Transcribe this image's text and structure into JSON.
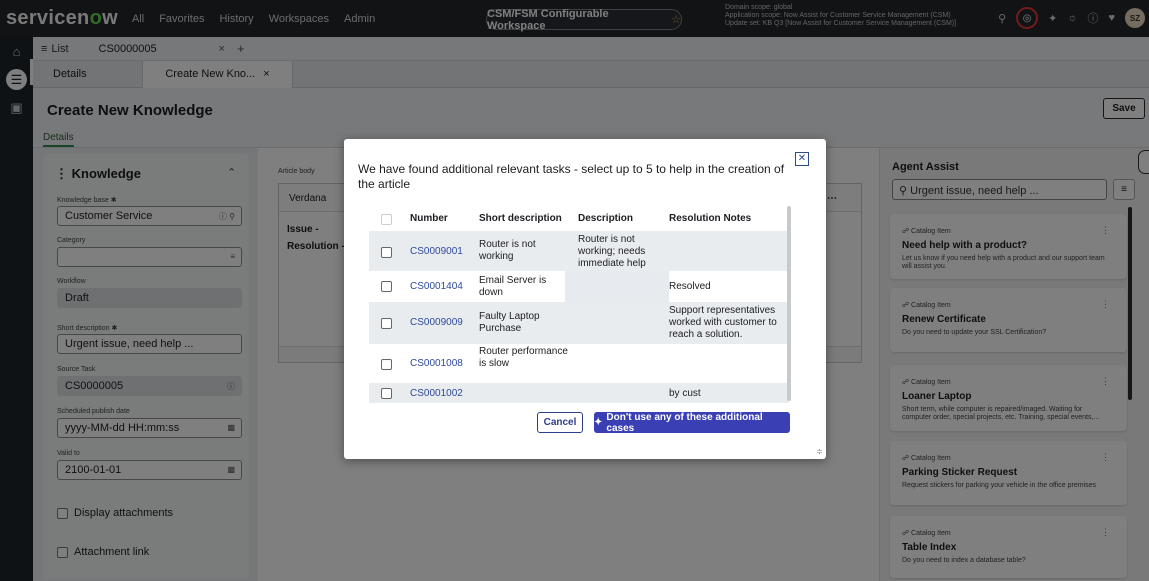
{
  "topbar": {
    "logo_pre": "servicen",
    "logo_o": "o",
    "logo_post": "w",
    "nav": [
      "All",
      "Favorites",
      "History",
      "Workspaces",
      "Admin"
    ],
    "workspace": "CSM/FSM Configurable Workspace",
    "scope_line1": "Domain scope: global",
    "scope_line2": "Application scope: Now Assist for Customer Service Management (CSM)",
    "scope_line3": "Update set: KB Q3 [Now Assist for Customer Service Management (CSM)]",
    "avatar": "SZ"
  },
  "tabs1": {
    "list": "List",
    "record": "CS0000005",
    "close": "×",
    "add": "+"
  },
  "tabs2": {
    "details": "Details",
    "create": "Create New Kno...",
    "close": "×"
  },
  "page": {
    "title": "Create New Knowledge",
    "subtab": "Details",
    "save": "Save"
  },
  "form": {
    "section": "Knowledge",
    "kb_label": "Knowledge base",
    "kb_value": "Customer Service",
    "category_label": "Category",
    "category_value": "",
    "workflow_label": "Workflow",
    "workflow_value": "Draft",
    "short_label": "Short description",
    "short_value": "Urgent issue, need help ...",
    "source_label": "Source Task",
    "source_value": "CS0000005",
    "sched_label": "Scheduled publish date",
    "sched_value": "yyyy-MM-dd HH:mm:ss",
    "valid_label": "Valid to",
    "valid_value": "2100-01-01",
    "display_attachments": "Display attachments",
    "attachment_link": "Attachment link"
  },
  "editor": {
    "label": "Article body",
    "font": "Verdana",
    "issue": "Issue -",
    "resolution": "Resolution -"
  },
  "assist": {
    "title": "Agent Assist",
    "search": "Urgent issue, need help ...",
    "cards": [
      {
        "type": "Catalog Item",
        "title": "Need help with a product?",
        "desc": "Let us know if you need help with a product and our support team will assist you."
      },
      {
        "type": "Catalog Item",
        "title": "Renew Certificate",
        "desc": "Do you need to update your SSL Certification?"
      },
      {
        "type": "Catalog Item",
        "title": "Loaner Laptop",
        "desc": "Short term, while computer is repaired/imaged. Waiting for computer order, special projects, etc. Training, special events,..."
      },
      {
        "type": "Catalog Item",
        "title": "Parking Sticker Request",
        "desc": "Request stickers for parking your vehicle in the office premises"
      },
      {
        "type": "Catalog Item",
        "title": "Table Index",
        "desc": "Do you need to index a database table?"
      }
    ]
  },
  "modal": {
    "title": "We have found additional relevant tasks - select up to 5 to help in the creation of the article",
    "headers": [
      "Number",
      "Short description",
      "Description",
      "Resolution Notes"
    ],
    "rows": [
      {
        "number": "CS0009001",
        "short": "Router is not working",
        "desc": "Router is not working; needs immediate help",
        "res": ""
      },
      {
        "number": "CS0001404",
        "short": "Email Server is down",
        "desc": "",
        "res": "Resolved"
      },
      {
        "number": "CS0009009",
        "short": "Faulty Laptop Purchase",
        "desc": "",
        "res": "Support representatives worked with customer to reach a solution."
      },
      {
        "number": "CS0001008",
        "short": "Router performance is slow",
        "desc": "",
        "res": ""
      },
      {
        "number": "CS0001002",
        "short": "",
        "desc": "",
        "res": "by cust"
      }
    ],
    "cancel": "Cancel",
    "dont_use": "Don't use any of these additional cases"
  }
}
